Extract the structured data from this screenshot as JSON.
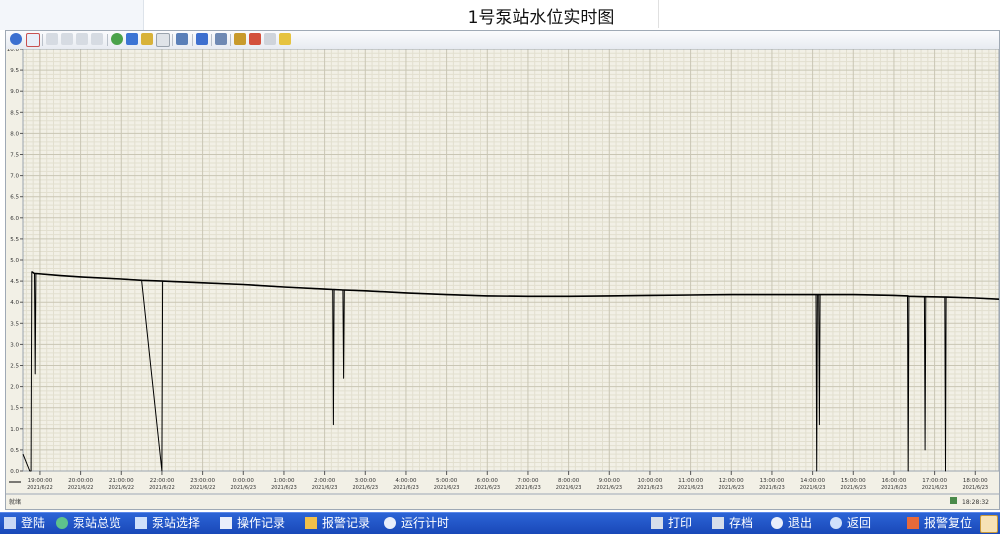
{
  "window": {
    "title": "1号泵站水位实时图"
  },
  "chart_data": {
    "type": "line",
    "title": "",
    "xlabel": "",
    "ylabel": "",
    "ylim": [
      0,
      10.0
    ],
    "xlim": [
      "2021-06-22 18:35:00",
      "2021-06-23 18:35:00"
    ],
    "y_ticks": [
      "0.0",
      "0.5",
      "1.0",
      "1.5",
      "2.0",
      "2.5",
      "3.0",
      "3.5",
      "4.0",
      "4.5",
      "5.0",
      "5.5",
      "6.0",
      "6.5",
      "7.0",
      "7.5",
      "8.0",
      "8.5",
      "9.0",
      "9.5",
      "10.0"
    ],
    "x_ticks": [
      {
        "time": "19:00:00",
        "date": "2021/6/22"
      },
      {
        "time": "20:00:00",
        "date": "2021/6/22"
      },
      {
        "time": "21:00:00",
        "date": "2021/6/22"
      },
      {
        "time": "22:00:00",
        "date": "2021/6/22"
      },
      {
        "time": "23:00:00",
        "date": "2021/6/22"
      },
      {
        "time": "0:00:00",
        "date": "2021/6/23"
      },
      {
        "time": "1:00:00",
        "date": "2021/6/23"
      },
      {
        "time": "2:00:00",
        "date": "2021/6/23"
      },
      {
        "time": "3:00:00",
        "date": "2021/6/23"
      },
      {
        "time": "4:00:00",
        "date": "2021/6/23"
      },
      {
        "time": "5:00:00",
        "date": "2021/6/23"
      },
      {
        "time": "6:00:00",
        "date": "2021/6/23"
      },
      {
        "time": "7:00:00",
        "date": "2021/6/23"
      },
      {
        "time": "8:00:00",
        "date": "2021/6/23"
      },
      {
        "time": "9:00:00",
        "date": "2021/6/23"
      },
      {
        "time": "10:00:00",
        "date": "2021/6/23"
      },
      {
        "time": "11:00:00",
        "date": "2021/6/23"
      },
      {
        "time": "12:00:00",
        "date": "2021/6/23"
      },
      {
        "time": "13:00:00",
        "date": "2021/6/23"
      },
      {
        "time": "14:00:00",
        "date": "2021/6/23"
      },
      {
        "time": "15:00:00",
        "date": "2021/6/23"
      },
      {
        "time": "16:00:00",
        "date": "2021/6/23"
      },
      {
        "time": "17:00:00",
        "date": "2021/6/23"
      },
      {
        "time": "18:00:00",
        "date": "2021/6/23"
      }
    ],
    "grid": true,
    "series": [
      {
        "color": "#000000",
        "points": [
          [
            "2021-06-22 18:35:00",
            0.4
          ],
          [
            "2021-06-22 18:45:00",
            0.0
          ],
          [
            "2021-06-22 18:47:00",
            0.0
          ],
          [
            "2021-06-22 18:48:00",
            4.72
          ],
          [
            "2021-06-22 18:52:00",
            4.68
          ],
          [
            "2021-06-22 18:53:00",
            2.3
          ],
          [
            "2021-06-22 18:54:00",
            4.68
          ],
          [
            "2021-06-22 19:30:00",
            4.63
          ],
          [
            "2021-06-22 20:00:00",
            4.6
          ],
          [
            "2021-06-22 21:00:00",
            4.55
          ],
          [
            "2021-06-22 21:30:00",
            4.52
          ],
          [
            "2021-06-22 22:00:00",
            0.0
          ],
          [
            "2021-06-22 22:01:00",
            4.5
          ],
          [
            "2021-06-22 23:00:00",
            4.46
          ],
          [
            "2021-06-23 00:00:00",
            4.42
          ],
          [
            "2021-06-23 01:00:00",
            4.36
          ],
          [
            "2021-06-23 02:00:00",
            4.31
          ],
          [
            "2021-06-23 02:12:00",
            4.3
          ],
          [
            "2021-06-23 02:13:00",
            1.1
          ],
          [
            "2021-06-23 02:14:00",
            4.3
          ],
          [
            "2021-06-23 02:27:00",
            4.29
          ],
          [
            "2021-06-23 02:28:00",
            2.2
          ],
          [
            "2021-06-23 02:29:00",
            4.29
          ],
          [
            "2021-06-23 03:00:00",
            4.27
          ],
          [
            "2021-06-23 04:00:00",
            4.22
          ],
          [
            "2021-06-23 05:00:00",
            4.18
          ],
          [
            "2021-06-23 06:00:00",
            4.15
          ],
          [
            "2021-06-23 07:00:00",
            4.14
          ],
          [
            "2021-06-23 08:00:00",
            4.14
          ],
          [
            "2021-06-23 09:00:00",
            4.15
          ],
          [
            "2021-06-23 10:00:00",
            4.16
          ],
          [
            "2021-06-23 11:00:00",
            4.17
          ],
          [
            "2021-06-23 12:00:00",
            4.18
          ],
          [
            "2021-06-23 13:00:00",
            4.18
          ],
          [
            "2021-06-23 14:00:00",
            4.18
          ],
          [
            "2021-06-23 14:05:00",
            4.18
          ],
          [
            "2021-06-23 14:06:00",
            0.0
          ],
          [
            "2021-06-23 14:07:00",
            4.18
          ],
          [
            "2021-06-23 14:09:00",
            4.18
          ],
          [
            "2021-06-23 14:10:00",
            1.1
          ],
          [
            "2021-06-23 14:11:00",
            4.18
          ],
          [
            "2021-06-23 15:00:00",
            4.18
          ],
          [
            "2021-06-23 16:00:00",
            4.16
          ],
          [
            "2021-06-23 16:20:00",
            4.15
          ],
          [
            "2021-06-23 16:21:00",
            0.0
          ],
          [
            "2021-06-23 16:22:00",
            4.14
          ],
          [
            "2021-06-23 16:45:00",
            4.13
          ],
          [
            "2021-06-23 16:46:00",
            0.5
          ],
          [
            "2021-06-23 16:47:00",
            4.13
          ],
          [
            "2021-06-23 17:15:00",
            4.12
          ],
          [
            "2021-06-23 17:16:00",
            0.0
          ],
          [
            "2021-06-23 17:17:00",
            4.12
          ],
          [
            "2021-06-23 18:00:00",
            4.1
          ],
          [
            "2021-06-23 18:35:00",
            4.07
          ]
        ]
      }
    ]
  },
  "status": {
    "left": "就绪",
    "right": "18:28:32"
  },
  "nav": {
    "login": "登陆",
    "overview": "泵站总览",
    "select": "泵站选择",
    "operation_log": "操作记录",
    "alarm_log": "报警记录",
    "runtime": "运行计时",
    "print": "打印",
    "save": "存档",
    "exit": "退出",
    "back": "返回",
    "alarm_reset": "报警复位"
  }
}
